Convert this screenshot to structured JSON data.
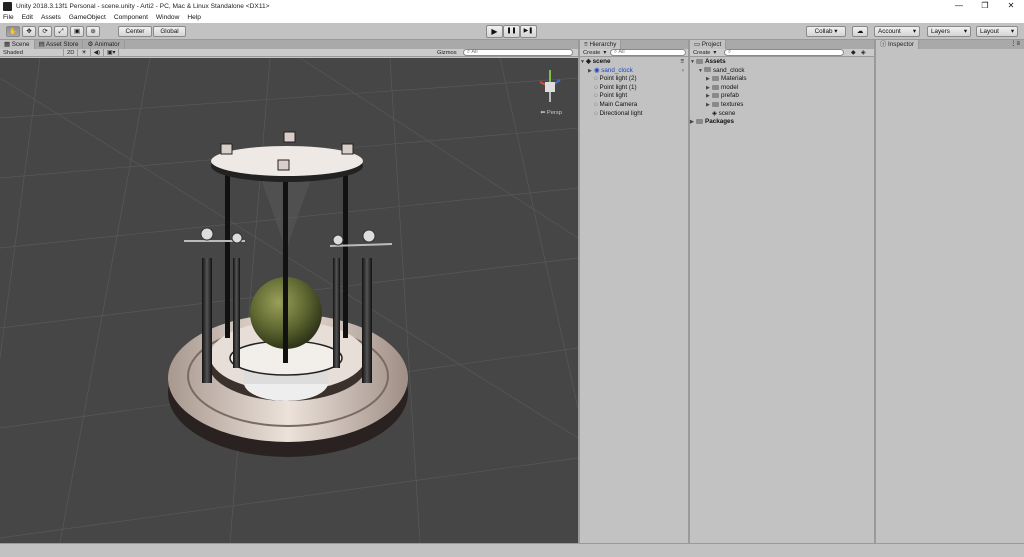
{
  "window": {
    "title": "Unity 2018.3.13f1 Personal - scene.unity - Arti2 - PC, Mac & Linux Standalone <DX11>",
    "controls": [
      "—",
      "❐",
      "✕"
    ]
  },
  "menu": [
    "File",
    "Edit",
    "Assets",
    "GameObject",
    "Component",
    "Window",
    "Help"
  ],
  "toolbar": {
    "tools": [
      "✋",
      "✥",
      "⟳",
      "⤢",
      "▣",
      "⊛"
    ],
    "pivot": "Center",
    "space": "Global",
    "play": "▶",
    "pause": "❚❚",
    "step": "▶❚",
    "collab": "Collab ▾",
    "cloud": "☁",
    "account": "Account",
    "layers": "Layers",
    "layout": "Layout"
  },
  "scene_panel": {
    "tabs": [
      "Scene",
      "Asset Store",
      "Animator"
    ],
    "shading": "Shaded",
    "mode2d": "2D",
    "gizmos": "Gizmos",
    "search_placeholder": "All",
    "persp_label": "⬅ Persp"
  },
  "hierarchy": {
    "tab": "Hierarchy",
    "create": "Create",
    "search_placeholder": "All",
    "scene_name": "scene",
    "items": [
      "sand_clock",
      "Point light (2)",
      "Point light (1)",
      "Point light",
      "Main Camera",
      "Directional light"
    ]
  },
  "project": {
    "tab": "Project",
    "create": "Create",
    "assets_label": "Assets",
    "sand_clock": "sand_clock",
    "children": [
      "Materials",
      "model",
      "prefab",
      "textures",
      "scene"
    ],
    "packages_label": "Packages"
  },
  "inspector": {
    "tab": "Inspector"
  },
  "colors": {
    "selection": "#1c45c9",
    "viewport_bg": "#464646",
    "panel_bg": "#c2c2c2"
  }
}
